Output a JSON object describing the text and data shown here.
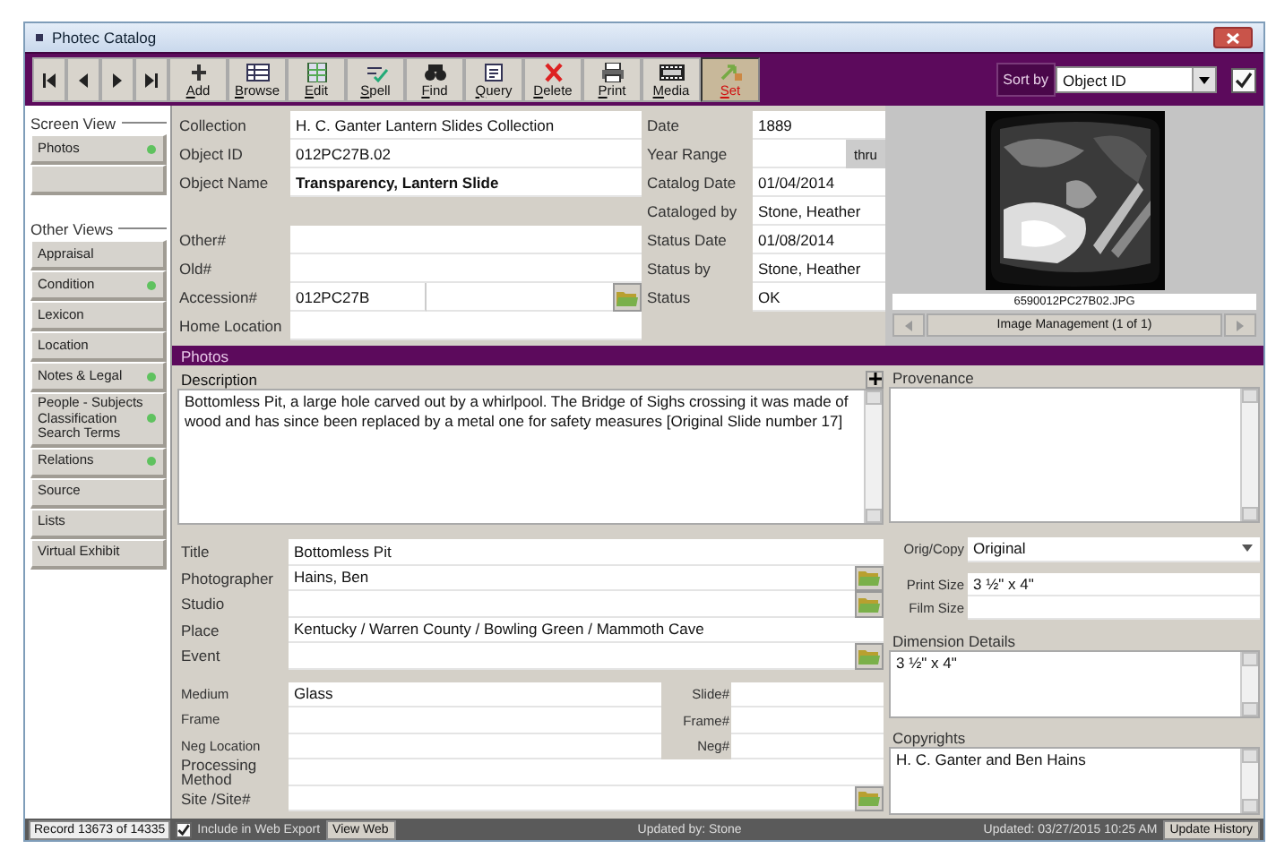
{
  "window": {
    "title": "Photec Catalog"
  },
  "toolbar": {
    "buttons": [
      {
        "label": "Add",
        "selected": false
      },
      {
        "label": "Browse",
        "selected": false
      },
      {
        "label": "Edit",
        "selected": false
      },
      {
        "label": "Spell",
        "selected": false
      },
      {
        "label": "Find",
        "selected": false
      },
      {
        "label": "Query",
        "selected": false
      },
      {
        "label": "Delete",
        "selected": false
      },
      {
        "label": "Print",
        "selected": false
      },
      {
        "label": "Media",
        "selected": false
      },
      {
        "label": "Set",
        "selected": true
      }
    ],
    "sort": {
      "label": "Sort by",
      "value": "Object ID"
    },
    "sort_checked": true
  },
  "sidebar": {
    "screen_view_heading": "Screen View",
    "screen_views": [
      {
        "label": "Photos",
        "indicator": true
      }
    ],
    "other_views_heading": "Other Views",
    "other_views": [
      {
        "label": "Appraisal",
        "indicator": false
      },
      {
        "label": "Condition",
        "indicator": true
      },
      {
        "label": "Lexicon",
        "indicator": false
      },
      {
        "label": "Location",
        "indicator": false
      },
      {
        "label": "Notes & Legal",
        "indicator": true
      },
      {
        "label": "People - Subjects Classification Search Terms",
        "indicator": true
      },
      {
        "label": "Relations",
        "indicator": true
      },
      {
        "label": "Source",
        "indicator": false
      },
      {
        "label": "Lists",
        "indicator": false
      },
      {
        "label": "Virtual Exhibit",
        "indicator": false
      }
    ]
  },
  "record": {
    "left": [
      {
        "label": "Collection",
        "value": "H. C. Ganter Lantern Slides Collection",
        "kind": "text"
      },
      {
        "label": "Object ID",
        "value": "012PC27B.02",
        "kind": "text"
      },
      {
        "label": "Object Name",
        "value": "Transparency, Lantern Slide",
        "kind": "bold"
      },
      {
        "kind": "spacer"
      },
      {
        "label": "Other#",
        "kind": "text"
      },
      {
        "label": "Old#",
        "kind": "text"
      },
      {
        "label": "Accession#",
        "value": "012PC27B",
        "kind": "lookup"
      },
      {
        "label": "Home Location",
        "kind": "text"
      }
    ],
    "middle": [
      {
        "label": "Date",
        "value": "1889",
        "kind": "text"
      },
      {
        "label": "Year Range",
        "between": "thru",
        "kind": "range"
      },
      {
        "label": "Catalog Date",
        "value": "01/04/2014",
        "kind": "text"
      },
      {
        "label": "Cataloged by",
        "value": "Stone, Heather",
        "kind": "text"
      },
      {
        "label": "Status Date",
        "value": "01/08/2014",
        "kind": "text"
      },
      {
        "label": "Status by",
        "value": "Stone, Heather",
        "kind": "text"
      },
      {
        "label": "Status",
        "value": "OK",
        "kind": "text"
      }
    ],
    "image": {
      "filename": "6590012PC27B02.JPG",
      "nav_label": "Image Management (1 of 1)"
    }
  },
  "section": {
    "title": "Photos"
  },
  "description": {
    "label": "Description",
    "value": "Bottomless Pit, a large hole carved out by a whirlpool.  The Bridge of Sighs crossing it was made of wood and has since been replaced by a metal one for safety measures [Original Slide number 17]"
  },
  "photo_fields": [
    {
      "label": "Title",
      "value": "Bottomless Pit",
      "kind": "single"
    },
    {
      "label": "Photographer",
      "value": "Hains, Ben",
      "kind": "lookup"
    },
    {
      "label": "Studio",
      "kind": "lookup"
    },
    {
      "label": "Place",
      "value": "Kentucky / Warren County / Bowling Green / Mammoth Cave",
      "kind": "single"
    },
    {
      "label": "Event",
      "kind": "lookup"
    },
    {
      "label": "Medium",
      "value": "Glass",
      "second_label": "Slide#",
      "kind": "paired"
    },
    {
      "label": "Frame",
      "second_label": "Frame#",
      "kind": "paired"
    },
    {
      "label": "Neg Location",
      "second_label": "Neg#",
      "kind": "paired"
    },
    {
      "label": "Processing Method",
      "kind": "single"
    },
    {
      "label": "Site /Site#",
      "kind": "site"
    }
  ],
  "provenance": {
    "label": "Provenance"
  },
  "orig_copy": {
    "label": "Orig/Copy",
    "value": "Original"
  },
  "print_size": {
    "label": "Print Size",
    "value": "3 ½\" x 4\""
  },
  "film_size": {
    "label": "Film Size"
  },
  "dimension_details": {
    "label": "Dimension Details",
    "value": "3 ½\" x 4\""
  },
  "copyrights": {
    "label": "Copyrights",
    "value": "H. C. Ganter and Ben Hains"
  },
  "status_bar": {
    "record": "Record 13673 of 14335",
    "web_export": {
      "label": "Include in Web Export",
      "checked": true
    },
    "view_web": "View Web",
    "updated_by": "Updated by: Stone",
    "updated": "Updated: 03/27/2015 10:25 AM",
    "update_history": "Update History"
  }
}
